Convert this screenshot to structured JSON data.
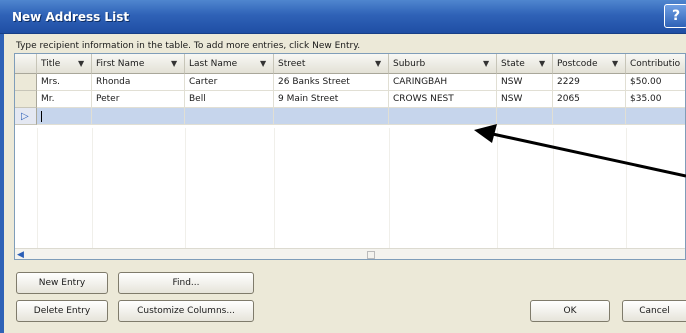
{
  "window": {
    "title": "New Address List",
    "help_label": "?"
  },
  "instruction": "Type recipient information in the table.  To add more entries, click New Entry.",
  "table": {
    "columns": [
      "Title",
      "First Name",
      "Last Name",
      "Street",
      "Suburb",
      "State",
      "Postcode",
      "Contributio"
    ],
    "rows": [
      [
        "Mrs.",
        "Rhonda",
        "Carter",
        "26 Banks Street",
        "CARINGBAH",
        "NSW",
        "2229",
        "$50.00"
      ],
      [
        "Mr.",
        "Peter",
        "Bell",
        "9 Main Street",
        "CROWS NEST",
        "NSW",
        "2065",
        "$35.00"
      ],
      [
        "",
        "",
        "",
        "",
        "",
        "",
        "",
        ""
      ]
    ],
    "new_row_pointer": "▷"
  },
  "buttons": {
    "new_entry": "New Entry",
    "find": "Find...",
    "delete_entry": "Delete Entry",
    "customize_columns": "Customize Columns...",
    "ok": "OK",
    "cancel": "Cancel"
  },
  "icons": {
    "sort_arrow": "▼",
    "scroll_left": "◀"
  },
  "colors": {
    "titlebar": "#2f62b7",
    "dialog_bg": "#ece9d8",
    "selected_row": "#c6d5ec"
  }
}
